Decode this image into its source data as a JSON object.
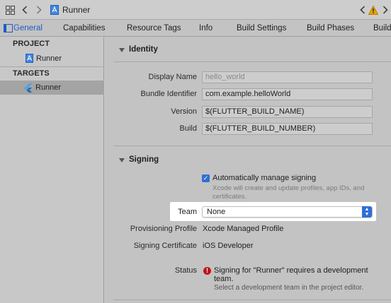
{
  "pathbar": {
    "project_name": "Runner"
  },
  "tabs": [
    {
      "label": "General",
      "active": true
    },
    {
      "label": "Capabilities",
      "active": false
    },
    {
      "label": "Resource Tags",
      "active": false
    },
    {
      "label": "Info",
      "active": false
    },
    {
      "label": "Build Settings",
      "active": false
    },
    {
      "label": "Build Phases",
      "active": false
    },
    {
      "label": "Build",
      "active": false
    }
  ],
  "sidebar": {
    "project_header": "PROJECT",
    "project_item": "Runner",
    "targets_header": "TARGETS",
    "target_item": "Runner"
  },
  "identity": {
    "title": "Identity",
    "display_name_label": "Display Name",
    "display_name_placeholder": "hello_world",
    "bundle_id_label": "Bundle Identifier",
    "bundle_id_value": "com.example.helloWorld",
    "version_label": "Version",
    "version_value": "$(FLUTTER_BUILD_NAME)",
    "build_label": "Build",
    "build_value": "$(FLUTTER_BUILD_NUMBER)"
  },
  "signing": {
    "title": "Signing",
    "auto_manage_label": "Automatically manage signing",
    "auto_manage_checked": true,
    "auto_manage_desc_1": "Xcode will create and update profiles, app IDs, and",
    "auto_manage_desc_2": "certificates.",
    "team_label": "Team",
    "team_value": "None",
    "profile_label": "Provisioning Profile",
    "profile_value": "Xcode Managed Profile",
    "cert_label": "Signing Certificate",
    "cert_value": "iOS Developer",
    "status_label": "Status",
    "status_msg_1": "Signing for \"Runner\" requires a development",
    "status_msg_2": "team.",
    "status_hint": "Select a development team in the project editor."
  },
  "colors": {
    "accent": "#2f6fd6",
    "error": "#c0121a",
    "warning": "#e8a400"
  }
}
